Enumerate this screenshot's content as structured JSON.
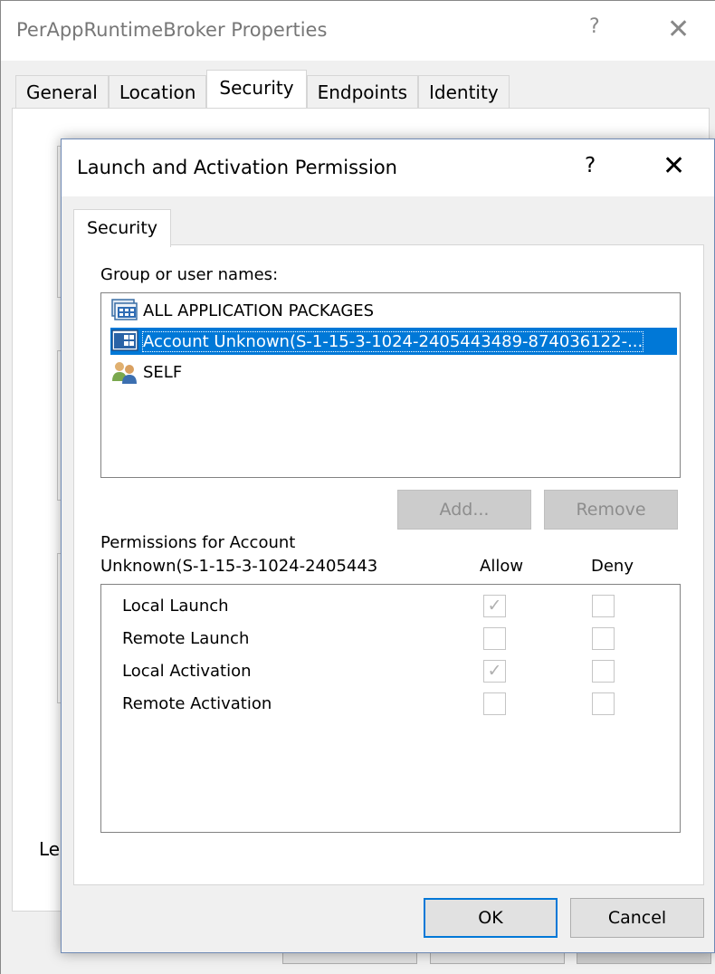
{
  "background_window": {
    "title": "PerAppRuntimeBroker Properties",
    "help_glyph": "?",
    "close_glyph": "✕",
    "tabs": [
      {
        "label": "General",
        "active": false
      },
      {
        "label": "Location",
        "active": false
      },
      {
        "label": "Security",
        "active": true
      },
      {
        "label": "Endpoints",
        "active": false
      },
      {
        "label": "Identity",
        "active": false
      }
    ],
    "partial_label": "Le"
  },
  "dialog": {
    "title": "Launch and Activation Permission",
    "help_glyph": "?",
    "close_glyph": "✕",
    "tab_label": "Security",
    "group_label": "Group or user names:",
    "users": [
      {
        "name": "ALL APPLICATION PACKAGES",
        "icon": "app-packages-icon",
        "selected": false
      },
      {
        "name": "Account Unknown(S-1-15-3-1024-2405443489-874036122-...",
        "icon": "unknown-account-icon",
        "selected": true
      },
      {
        "name": "SELF",
        "icon": "users-group-icon",
        "selected": false
      }
    ],
    "add_button": "Add...",
    "remove_button": "Remove",
    "permissions_label_line1": "Permissions for Account",
    "permissions_label_line2": "Unknown(S-1-15-3-1024-2405443",
    "allow_header": "Allow",
    "deny_header": "Deny",
    "permissions": [
      {
        "name": "Local Launch",
        "allow": true,
        "deny": false
      },
      {
        "name": "Remote Launch",
        "allow": false,
        "deny": false
      },
      {
        "name": "Local Activation",
        "allow": true,
        "deny": false
      },
      {
        "name": "Remote Activation",
        "allow": false,
        "deny": false
      }
    ],
    "check_glyph": "✓",
    "ok_button": "OK",
    "cancel_button": "Cancel"
  },
  "colors": {
    "selection": "#0078d7",
    "window_bg": "#f0f0f0",
    "disabled_text": "#8d8d8d"
  }
}
